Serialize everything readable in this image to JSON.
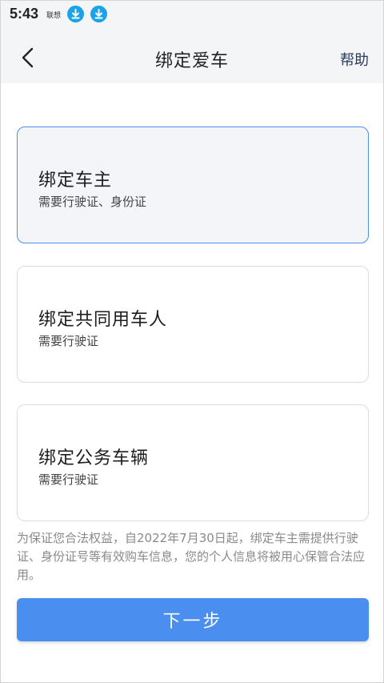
{
  "status_bar": {
    "time": "5:43",
    "carrier": "联想",
    "notification_icons": [
      "download-icon",
      "download-icon"
    ],
    "icon_color": "#1aa3e8"
  },
  "nav": {
    "back_icon": "chevron-left-icon",
    "title": "绑定爱车",
    "help_label": "帮助"
  },
  "options": [
    {
      "title": "绑定车主",
      "subtitle": "需要行驶证、身份证",
      "selected": true
    },
    {
      "title": "绑定共同用车人",
      "subtitle": "需要行驶证",
      "selected": false
    },
    {
      "title": "绑定公务车辆",
      "subtitle": "需要行驶证",
      "selected": false
    }
  ],
  "notice": "为保证您合法权益，自2022年7月30日起，绑定车主需提供行驶证、身份证号等有效购车信息，您的个人信息将被用心保管合法应用。",
  "next_button_label": "下一步",
  "colors": {
    "accent": "#4a8ef0",
    "selected_border": "#4b8ff0",
    "selected_bg": "#f3f5f9",
    "notice_text": "#8a8a8a"
  }
}
